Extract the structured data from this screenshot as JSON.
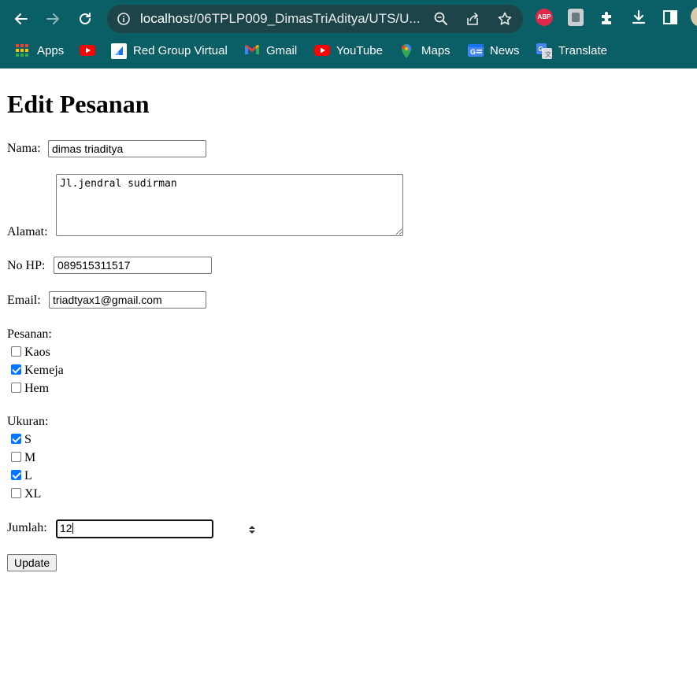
{
  "browser": {
    "url_host": "localhost",
    "url_path": "/06TPLP009_DimasTriAditya/UTS/U...",
    "bookmarks": [
      {
        "label": "Apps",
        "icon": "apps-grid-icon"
      },
      {
        "label": "",
        "icon": "youtube-icon"
      },
      {
        "label": "Red Group Virtual",
        "icon": "red-group-icon"
      },
      {
        "label": "Gmail",
        "icon": "gmail-icon"
      },
      {
        "label": "YouTube",
        "icon": "youtube-icon"
      },
      {
        "label": "Maps",
        "icon": "maps-pin-icon"
      },
      {
        "label": "News",
        "icon": "news-icon"
      },
      {
        "label": "Translate",
        "icon": "translate-icon"
      }
    ],
    "extensions": [
      "adblock-icon",
      "extension-icon",
      "puzzle-icon",
      "download-icon",
      "sidepanel-icon"
    ],
    "adblock_label": "ABP",
    "colors": {
      "toolbar": "#0a5e66",
      "omnibox": "#1d4448",
      "accent": "#0075ff"
    }
  },
  "form": {
    "title": "Edit Pesanan",
    "nama_label": "Nama:",
    "nama_value": "dimas triaditya",
    "alamat_label": "Alamat:",
    "alamat_value": "Jl.jendral sudirman",
    "hp_label": "No HP:",
    "hp_value": "089515311517",
    "email_label": "Email:",
    "email_value": "triadtyax1@gmail.com",
    "pesanan_label": "Pesanan:",
    "pesanan_options": [
      {
        "label": "Kaos",
        "checked": false
      },
      {
        "label": "Kemeja",
        "checked": true
      },
      {
        "label": "Hem",
        "checked": false
      }
    ],
    "ukuran_label": "Ukuran:",
    "ukuran_options": [
      {
        "label": "S",
        "checked": true
      },
      {
        "label": "M",
        "checked": false
      },
      {
        "label": "L",
        "checked": true
      },
      {
        "label": "XL",
        "checked": false
      }
    ],
    "jumlah_label": "Jumlah:",
    "jumlah_value": "12",
    "update_label": "Update"
  }
}
